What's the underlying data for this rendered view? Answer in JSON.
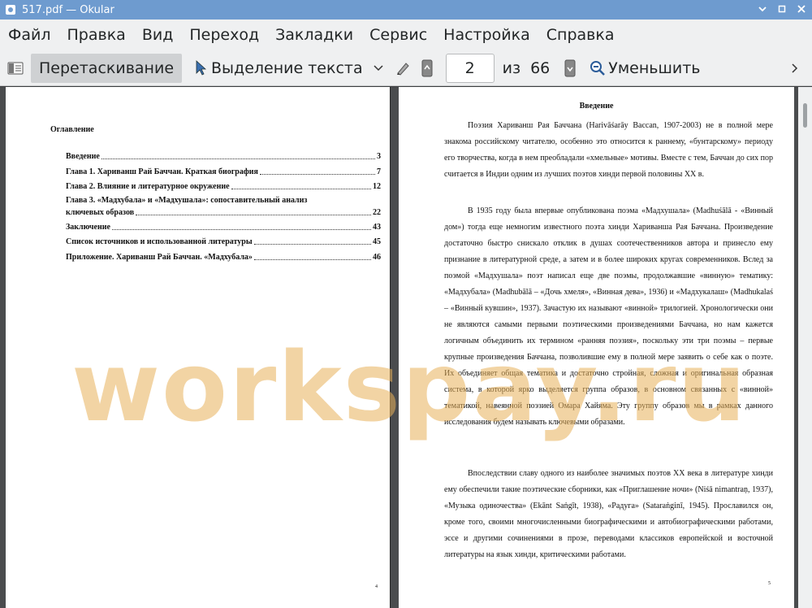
{
  "window": {
    "title": "517.pdf  — Okular"
  },
  "menubar": {
    "items": [
      "Файл",
      "Правка",
      "Вид",
      "Переход",
      "Закладки",
      "Сервис",
      "Настройка",
      "Справка"
    ]
  },
  "toolbar": {
    "browse_label": "Перетаскивание",
    "text_select_label": "Выделение текста",
    "page_value": "2",
    "of_label": "из",
    "total_pages": "66",
    "zoom_out_label": "Уменьшить"
  },
  "left_page": {
    "toc_title": "Оглавление",
    "toc": [
      {
        "label": "Введение",
        "page": "3"
      },
      {
        "label": "Глава 1. Хариванш Рай Баччан. Краткая биография",
        "page": "7"
      },
      {
        "label": "Глава 2. Влияние и литературное окружение",
        "page": "12"
      },
      {
        "label_line1": "Глава 3. «Мадхубала» и «Мадхушала»: сопоставительный анализ",
        "label": "ключевых образов",
        "page": "22"
      },
      {
        "label": "Заключение",
        "page": "43"
      },
      {
        "label": "Список источников и использованной литературы",
        "page": "45"
      },
      {
        "label": "Приложение. Хариванш Рай Баччан. «Мадхубала»",
        "page": "46"
      }
    ],
    "page_number": "4"
  },
  "right_page": {
    "title": "Введение",
    "paragraphs": [
      "Поэзия Хариванш Рая Баччана (Harivāśarāy Baccan, 1907-2003) не в полной мере знакома российскому читателю, особенно это относится к раннему, «бунтарскому» периоду его творчества, когда в нем преобладали «хмельные» мотивы. Вместе с тем, Баччан до сих пор считается в Индии одним из лучших поэтов хинди первой половины XX в.",
      "В 1935 году была впервые опубликована поэма «Мадхушала» (Madhuśālā - «Винный дом») тогда еще немногим известного поэта хинди Хариванша Рая Баччана. Произведение достаточно быстро снискало отклик в душах соотечественников автора и принесло ему признание в литературной среде, а затем и в более широких кругах современников. Вслед за поэмой «Мадхушала» поэт написал еще две поэмы, продолжавшие «винную» тематику: «Мадхубала» (Madhubālā – «Дочь хмеля», «Винная дева», 1936) и «Мадхукалаш» (Madhukalaś – «Винный кувшин», 1937). Зачастую их называют «винной» трилогией. Хронологически они не являются самыми первыми поэтическими произведениями Баччана, но нам кажется логичным объединить их термином «ранняя поэзия», поскольку эти три поэмы – первые крупные произведения Баччана, позволившие ему в полной мере заявить о себе как о поэте. Их объединяет общая тематика и достаточно стройная, сложная и оригинальная образная система, в которой ярко выделяется группа образов, в основном связанных с «винной» тематикой, навеянной поэзией Омара Хайяма. Эту группу образов мы в рамках данного исследования будем называть ключевыми образами.",
      "Впоследствии славу одного из наиболее значимых поэтов XX века в литературе хинди ему обеспечили такие поэтические сборники, как «Приглашение ночи» (Niśā nimantraṇ, 1937), «Музыка одиночества» (Ekānt Saṅgīt, 1938), «Радуга» (Sataraṅginī, 1945). Прославился он, кроме того, своими многочисленными биографическими и автобиографическими работами, эссе и другими сочинениями в прозе, переводами классиков европейской и восточной литературы на язык хинди, критическими работами."
    ],
    "page_number": "5"
  },
  "watermark": "workspay.ru",
  "colors": {
    "titlebar": "#6e9bcf",
    "chrome": "#eff0f1",
    "watermark": "#e8b05a"
  }
}
